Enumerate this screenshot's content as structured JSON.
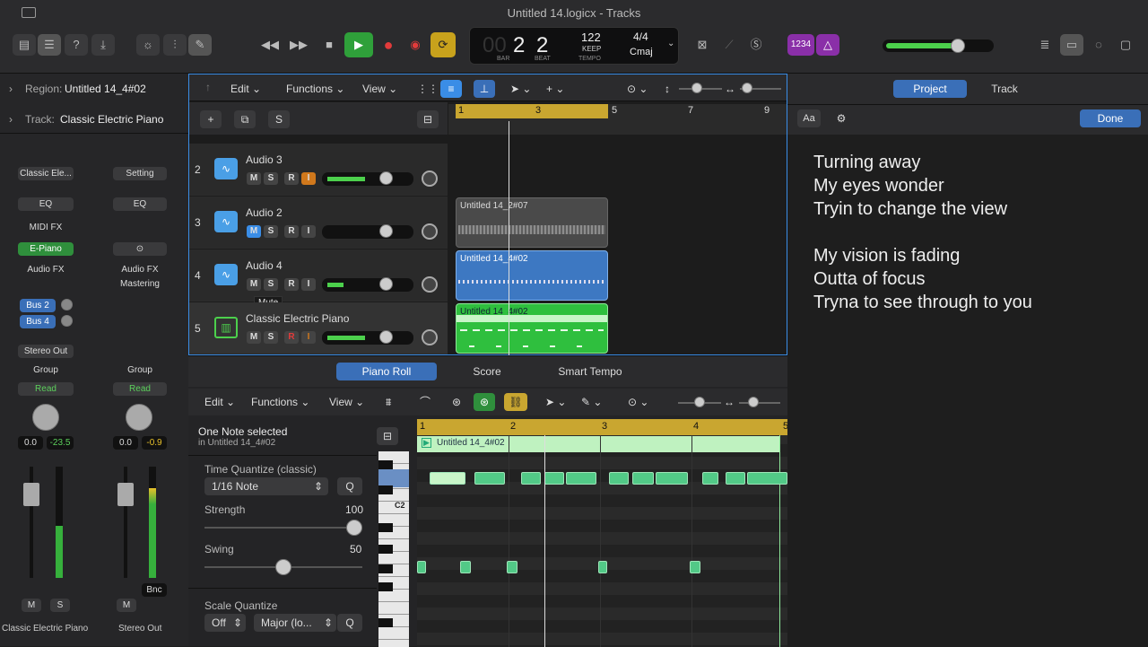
{
  "window": {
    "title": "Untitled 14.logicx - Tracks"
  },
  "lcd": {
    "bar": "2",
    "beat": "2",
    "bar_prefix": "00",
    "bar_label": "BAR",
    "beat_label": "BEAT",
    "tempo": "122",
    "tempo_mode": "KEEP",
    "tempo_label": "TEMPO",
    "signature": "4/4",
    "key": "Cmaj"
  },
  "toolbar": {
    "count_in": "1234"
  },
  "inspector": {
    "region_label": "Region:",
    "region_name": "Untitled 14_4#02",
    "track_label": "Track:",
    "track_name": "Classic Electric Piano",
    "strip1": {
      "instrument": "Classic Ele...",
      "eq": "EQ",
      "midi_fx": "MIDI FX",
      "plugin": "E-Piano",
      "audio_fx": "Audio FX",
      "send1": "Bus 2",
      "send2": "Bus 4",
      "output": "Stereo Out",
      "group": "Group",
      "automation": "Read",
      "vol": "0.0",
      "peak": "-23.5",
      "mute": "M",
      "solo": "S",
      "name": "Classic Electric Piano"
    },
    "strip2": {
      "setting": "Setting",
      "eq": "EQ",
      "audio_fx": "Audio FX",
      "mastering": "Mastering",
      "group": "Group",
      "automation": "Read",
      "vol": "0.0",
      "peak": "-0.9",
      "mute": "M",
      "bnc": "Bnc",
      "name": "Stereo Out"
    }
  },
  "tracks_header": {
    "edit": "Edit",
    "functions": "Functions",
    "view": "View",
    "add": "+",
    "solo": "S",
    "ruler": [
      "1",
      "3",
      "5",
      "7",
      "9"
    ]
  },
  "tracks": [
    {
      "num": "2",
      "name": "Audio 3",
      "m": "M",
      "s": "S",
      "r": "R",
      "i": "I"
    },
    {
      "num": "3",
      "name": "Audio 2",
      "m": "M",
      "s": "S",
      "r": "R",
      "i": "I"
    },
    {
      "num": "4",
      "name": "Audio 4",
      "m": "M",
      "s": "S",
      "r": "R",
      "i": "I",
      "tooltip": "Mute"
    },
    {
      "num": "5",
      "name": "Classic Electric Piano",
      "m": "M",
      "s": "S",
      "r": "R",
      "i": "I"
    }
  ],
  "regions": [
    {
      "name": "Untitled 14_2#07"
    },
    {
      "name": "Untitled 14_4#02"
    },
    {
      "name": "Untitled 14_4#02"
    }
  ],
  "editor": {
    "tabs": [
      "Piano Roll",
      "Score",
      "Smart Tempo"
    ],
    "edit": "Edit",
    "functions": "Functions",
    "view": "View",
    "selection": "One Note selected",
    "selection_sub": "in Untitled 14_4#02",
    "tq_label": "Time Quantize (classic)",
    "tq_value": "1/16 Note",
    "q": "Q",
    "strength_label": "Strength",
    "strength": "100",
    "swing_label": "Swing",
    "swing": "50",
    "sq_label": "Scale Quantize",
    "sq_off": "Off",
    "sq_scale": "Major (lo...",
    "sq_q": "Q",
    "key_c2": "C2",
    "ruler": [
      "1",
      "2",
      "3",
      "4",
      "5"
    ],
    "region_name": "Untitled 14_4#02"
  },
  "right_panel": {
    "tab_project": "Project",
    "tab_track": "Track",
    "aa": "Aa",
    "done": "Done",
    "lyrics": [
      "Turning away",
      "My eyes wonder",
      "Tryin to change the view",
      "",
      "My vision is fading",
      "Outta of focus",
      "Tryna to see through to you"
    ]
  },
  "colors": {
    "accent": "#3a8de6",
    "region_blue": "#3d78c2",
    "region_green": "#2fbf3e",
    "ruler_yellow": "#c9a630",
    "note_green": "#52c987"
  }
}
